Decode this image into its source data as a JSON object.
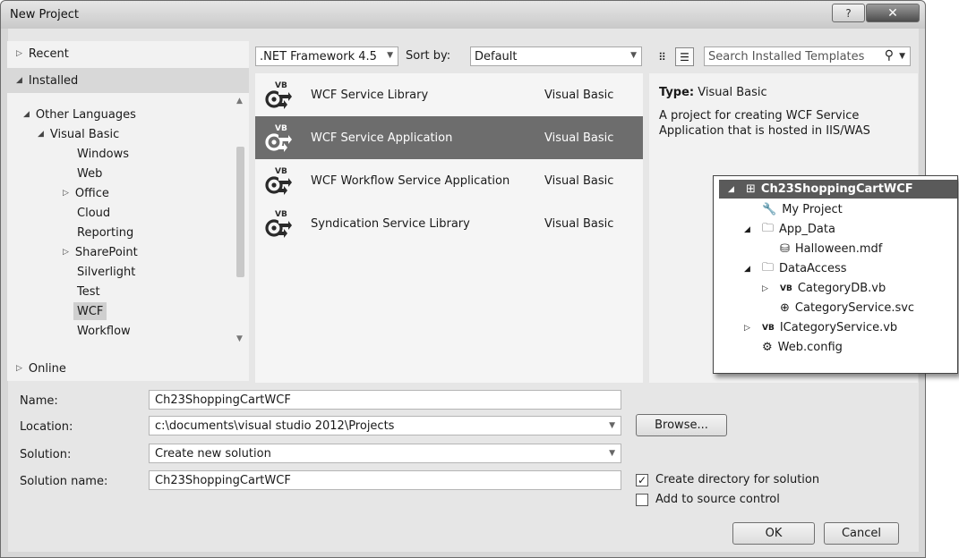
{
  "window": {
    "title": "New Project",
    "help_label": "?",
    "close_label": "✕"
  },
  "left_nav": {
    "recent": "Recent",
    "installed": "Installed",
    "online": "Online",
    "tree": [
      {
        "label": "Other Languages",
        "indent": 1,
        "expander": "◢"
      },
      {
        "label": "Visual Basic",
        "indent": 2,
        "expander": "◢"
      },
      {
        "label": "Windows",
        "indent": 3,
        "expander": ""
      },
      {
        "label": "Web",
        "indent": 3,
        "expander": ""
      },
      {
        "label": "Office",
        "indent": 3,
        "expander": "▷"
      },
      {
        "label": "Cloud",
        "indent": 3,
        "expander": ""
      },
      {
        "label": "Reporting",
        "indent": 3,
        "expander": ""
      },
      {
        "label": "SharePoint",
        "indent": 3,
        "expander": "▷"
      },
      {
        "label": "Silverlight",
        "indent": 3,
        "expander": ""
      },
      {
        "label": "Test",
        "indent": 3,
        "expander": ""
      },
      {
        "label": "WCF",
        "indent": 3,
        "expander": "",
        "selected": true
      },
      {
        "label": "Workflow",
        "indent": 3,
        "expander": ""
      }
    ]
  },
  "toolbar": {
    "framework": ".NET Framework 4.5",
    "sort_label": "Sort by:",
    "sort_value": "Default",
    "search_placeholder": "Search Installed Templates (Ctrl+E)",
    "grid_view_icon": "small-icons-view-icon",
    "list_view_icon": "list-view-icon"
  },
  "templates": [
    {
      "name": "WCF Service Library",
      "language": "Visual Basic",
      "selected": false
    },
    {
      "name": "WCF Service Application",
      "language": "Visual Basic",
      "selected": true
    },
    {
      "name": "WCF Workflow Service Application",
      "language": "Visual Basic",
      "selected": false
    },
    {
      "name": "Syndication Service Library",
      "language": "Visual Basic",
      "selected": false
    }
  ],
  "details": {
    "type_label": "Type:",
    "type_value": "Visual Basic",
    "description": "A project for creating WCF Service Application that is hosted in IIS/WAS"
  },
  "solution_explorer": [
    {
      "label": "Ch23ShoppingCartWCF",
      "level": 0,
      "expander": "◢",
      "icon": "web-project-icon",
      "selected": true
    },
    {
      "label": "My Project",
      "level": 1,
      "expander": "",
      "icon": "wrench-icon"
    },
    {
      "label": "App_Data",
      "level": 1,
      "expander": "◢",
      "icon": "folder-icon"
    },
    {
      "label": "Halloween.mdf",
      "level": 2,
      "expander": "",
      "icon": "database-icon"
    },
    {
      "label": "DataAccess",
      "level": 1,
      "expander": "◢",
      "icon": "folder-icon"
    },
    {
      "label": "CategoryDB.vb",
      "level": 2,
      "expander": "▷",
      "icon": "vb-file-icon"
    },
    {
      "label": "CategoryService.svc",
      "level": 2,
      "expander": "",
      "icon": "service-file-icon"
    },
    {
      "label": "ICategoryService.vb",
      "level": 1,
      "expander": "▷",
      "icon": "vb-file-icon"
    },
    {
      "label": "Web.config",
      "level": 1,
      "expander": "",
      "icon": "config-file-icon"
    }
  ],
  "form": {
    "name_label": "Name:",
    "name_value": "Ch23ShoppingCartWCF",
    "location_label": "Location:",
    "location_value": "c:\\documents\\visual studio 2012\\Projects",
    "solution_label": "Solution:",
    "solution_value": "Create new solution",
    "solution_name_label": "Solution name:",
    "solution_name_value": "Ch23ShoppingCartWCF",
    "browse_label": "Browse...",
    "create_dir_label": "Create directory for solution",
    "create_dir_checked": true,
    "source_control_label": "Add to source control",
    "source_control_checked": false,
    "ok_label": "OK",
    "cancel_label": "Cancel"
  }
}
